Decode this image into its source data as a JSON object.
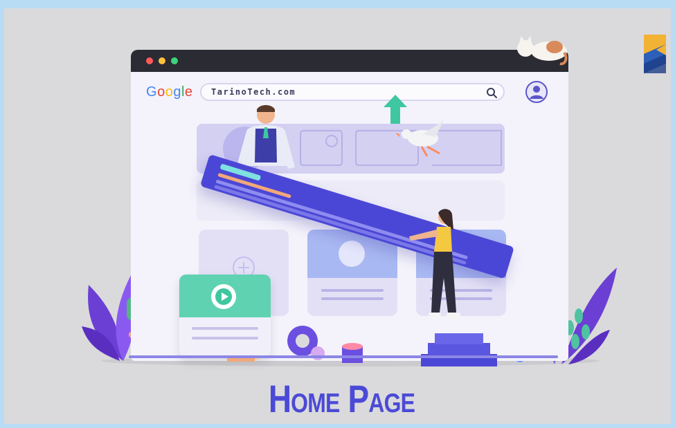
{
  "browser": {
    "search_engine_logo": [
      "G",
      "o",
      "o",
      "g",
      "l",
      "e"
    ],
    "search_input_value": "TarinoTech.com",
    "icons": {
      "search": "search-icon",
      "avatar": "user-avatar-icon",
      "play": "play-icon",
      "plus": "plus-icon"
    }
  },
  "page": {
    "title": "Home Page"
  },
  "colors": {
    "accent": "#4b4ad6",
    "titlebar": "#2b2b33",
    "video_card": "#5fd2b2",
    "google": [
      "#4285f4",
      "#ea4335",
      "#fbbc05",
      "#4285f4",
      "#34a853",
      "#ea4335"
    ]
  }
}
